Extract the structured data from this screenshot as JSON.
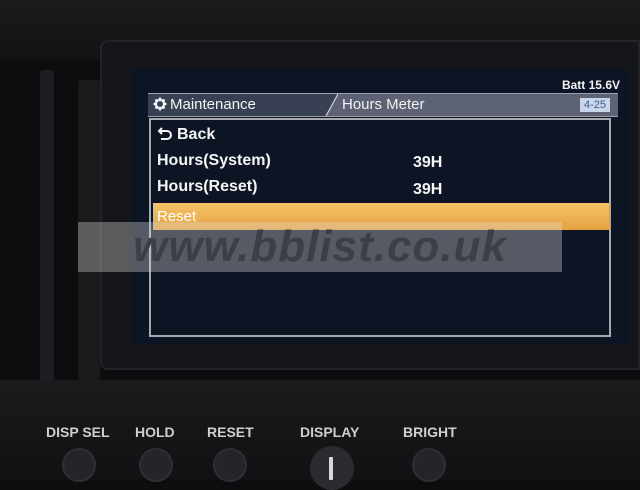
{
  "screen": {
    "battery": "Batt 15.6V",
    "title_bar": {
      "section": "Maintenance",
      "subtitle": "Hours Meter",
      "page": "4-25"
    },
    "menu": {
      "back_label": "Back",
      "items": [
        {
          "label": "Hours(System)",
          "value": "39H"
        },
        {
          "label": "Hours(Reset)",
          "value": "39H"
        }
      ],
      "selected_label": "Reset"
    }
  },
  "watermark": "www.bblist.co.uk",
  "controls": {
    "disp_sel": "DISP SEL",
    "hold": "HOLD",
    "reset": "RESET",
    "display": "DISPLAY",
    "bright": "BRIGHT"
  },
  "colors": {
    "highlight": "#e6a23f",
    "screen_bg": "#0d1524",
    "title_bar": "#5d6374"
  },
  "icons": {
    "gear": "gear-icon",
    "back": "back-arrow-icon"
  }
}
